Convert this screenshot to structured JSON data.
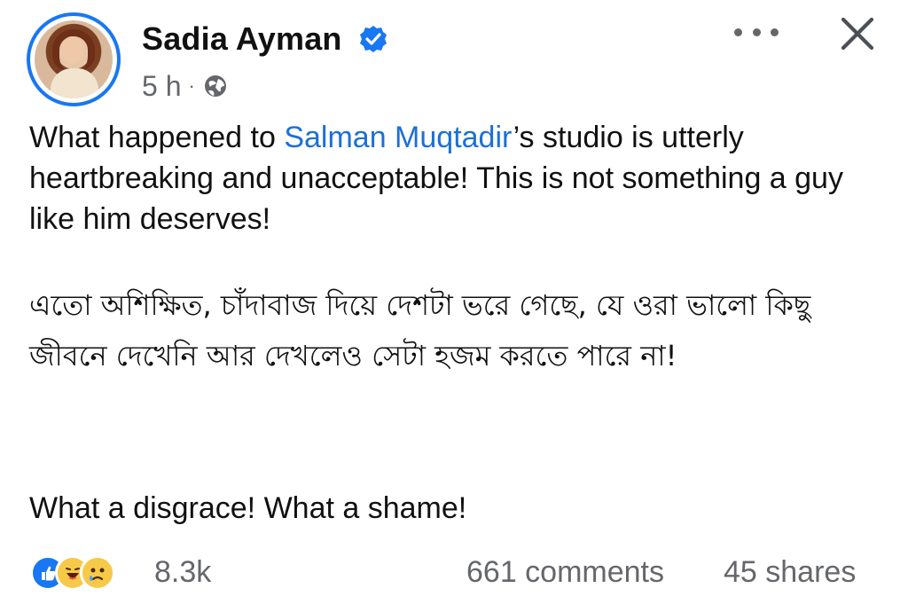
{
  "header": {
    "author_name": "Sadia Ayman",
    "time": "5 h",
    "separator": "·",
    "privacy_icon": "globe-icon",
    "verified_icon": "verified-badge-icon",
    "more_icon": "more-options-icon",
    "close_icon": "close-icon"
  },
  "post": {
    "line1_prefix": "What happened to ",
    "mention": "Salman Muqtadir",
    "line1_suffix": "’s studio is utterly heartbreaking and unacceptable! This is not something a guy like him deserves!",
    "bangla": "এতো অশিক্ষিত, চাঁদাবাজ দিয়ে দেশটা ভরে গেছে, যে ওরা ভালো কিছু জীবনে দেখেনি আর দেখলেও সেটা হজম করতে পারে না!",
    "closing": "What a disgrace! What a shame!"
  },
  "footer": {
    "reactions": [
      "like",
      "haha",
      "sad"
    ],
    "reaction_count": "8.3k",
    "comments": "661 comments",
    "shares": "45 shares"
  },
  "colors": {
    "accent": "#1877f2",
    "mention": "#1d6fd6",
    "muted": "#65676b"
  }
}
